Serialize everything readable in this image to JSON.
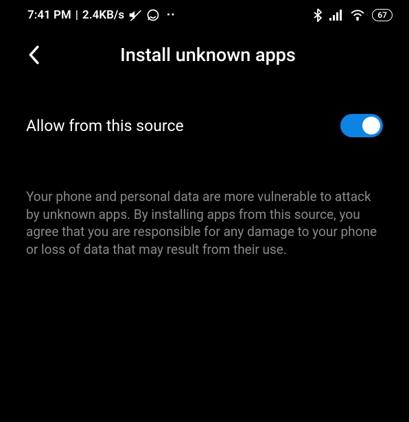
{
  "statusBar": {
    "time": "7:41 PM",
    "separator": "|",
    "dataRate": "2.4KB/s",
    "battery": "67"
  },
  "header": {
    "title": "Install unknown apps"
  },
  "setting": {
    "label": "Allow from this source",
    "enabled": true
  },
  "description": "Your phone and personal data are more vulnerable to attack by unknown apps. By installing apps from this source, you agree that you are responsible for any damage to your phone or loss of data that may result from their use."
}
